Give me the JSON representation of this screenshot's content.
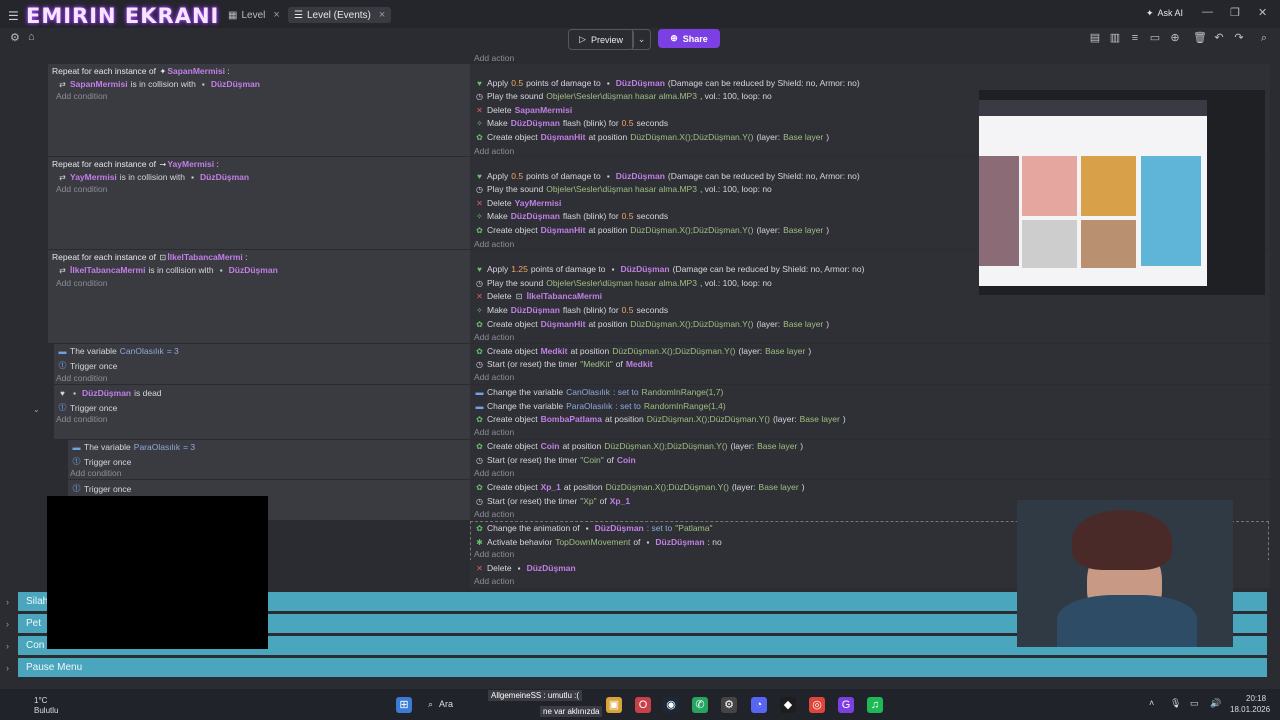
{
  "overlay": {
    "stream_title": "EMIRIN EKRANI"
  },
  "tabs": [
    {
      "label": "Level"
    },
    {
      "label": "Level (Events)"
    }
  ],
  "header": {
    "ask_ai": "Ask AI",
    "preview": "Preview",
    "share": "Share"
  },
  "events": [
    {
      "repeat": "Repeat for each instance of",
      "repeat_obj": "SapanMermisi",
      "cond_obj": "SapanMermisi",
      "cond_mid": "is in collision with",
      "cond_target": "DüzDüşman",
      "add_condition": "Add condition",
      "actions": [
        [
          "Apply",
          "0.5",
          "points of damage to",
          "DüzDüşman",
          "(Damage can be reduced by Shield: no, Armor: no)"
        ],
        [
          "Play the sound",
          "Objeler\\Sesler\\düşman hasar alma.MP3",
          ", vol.: 100, loop: no"
        ],
        [
          "Delete",
          "SapanMermisi"
        ],
        [
          "Make",
          "DüzDüşman",
          "flash (blink) for",
          "0.5",
          "seconds"
        ],
        [
          "Create object",
          "DüşmanHit",
          "at position",
          "DüzDüşman.X();DüzDüşman.Y()",
          "(layer:",
          "Base layer",
          ")"
        ]
      ],
      "add_action": "Add action"
    },
    {
      "repeat": "Repeat for each instance of",
      "repeat_obj": "YayMermisi",
      "cond_obj": "YayMermisi",
      "cond_mid": "is in collision with",
      "cond_target": "DüzDüşman",
      "add_condition": "Add condition",
      "actions": [
        [
          "Apply",
          "0.5",
          "points of damage to",
          "DüzDüşman",
          "(Damage can be reduced by Shield: no, Armor: no)"
        ],
        [
          "Play the sound",
          "Objeler\\Sesler\\düşman hasar alma.MP3",
          ", vol.: 100, loop: no"
        ],
        [
          "Delete",
          "YayMermisi"
        ],
        [
          "Make",
          "DüzDüşman",
          "flash (blink) for",
          "0.5",
          "seconds"
        ],
        [
          "Create object",
          "DüşmanHit",
          "at position",
          "DüzDüşman.X();DüzDüşman.Y()",
          "(layer:",
          "Base layer",
          ")"
        ]
      ],
      "add_action": "Add action"
    },
    {
      "repeat": "Repeat for each instance of",
      "repeat_obj": "İlkelTabancaMermi",
      "cond_obj": "İlkelTabancaMermi",
      "cond_mid": "is in collision with",
      "cond_target": "DüzDüşman",
      "add_condition": "Add condition",
      "actions": [
        [
          "Apply",
          "1.25",
          "points of damage to",
          "DüzDüşman",
          "(Damage can be reduced by Shield: no, Armor: no)"
        ],
        [
          "Play the sound",
          "Objeler\\Sesler\\düşman hasar alma.MP3",
          ", vol.: 100, loop: no"
        ],
        [
          "Delete",
          "İlkelTabancaMermi"
        ],
        [
          "Make",
          "DüzDüşman",
          "flash (blink) for",
          "0.5",
          "seconds"
        ],
        [
          "Create object",
          "DüşmanHit",
          "at position",
          "DüzDüşman.X();DüzDüşman.Y()",
          "(layer:",
          "Base layer",
          ")"
        ]
      ],
      "add_action": "Add action"
    }
  ],
  "medkit_event": {
    "cond1": "The variable",
    "var": "CanOlasılık",
    "eq": "= 3",
    "cond2": "Trigger once",
    "add_condition": "Add condition",
    "act1": [
      "Create object",
      "Medkit",
      "at position",
      "DüzDüşman.X();DüzDüşman.Y()",
      "(layer:",
      "Base layer",
      ")"
    ],
    "act2": [
      "Start (or reset) the timer",
      "\"MedKit\"",
      "of",
      "Medkit"
    ],
    "add_action": "Add action"
  },
  "dead_event": {
    "obj": "DüzDüşman",
    "cond": "is dead",
    "cond2": "Trigger once",
    "add_condition": "Add condition",
    "act1": [
      "Change the variable",
      "CanOlasılık",
      ": set to",
      "RandomInRange(1,7)"
    ],
    "act2": [
      "Change the variable",
      "ParaOlasılık",
      ": set to",
      "RandomInRange(1,4)"
    ],
    "act3": [
      "Create object",
      "BombaPatlama",
      "at position",
      "DüzDüşman.X();DüzDüşman.Y()",
      "(layer:",
      "Base layer",
      ")"
    ],
    "add_action": "Add action"
  },
  "coin_event": {
    "cond1": "The variable",
    "var": "ParaOlasılık",
    "eq": "= 3",
    "cond2": "Trigger once",
    "add_condition": "Add condition",
    "act1": [
      "Create object",
      "Coin",
      "at position",
      "DüzDüşman.X();DüzDüşman.Y()",
      "(layer:",
      "Base layer",
      ")"
    ],
    "act2": [
      "Start (or reset) the timer",
      "\"Coin\"",
      "of",
      "Coin"
    ],
    "add_action": "Add action"
  },
  "xp_event": {
    "cond": "Trigger once",
    "act1": [
      "Create object",
      "Xp_1",
      "at position",
      "DüzDüşman.X();DüzDüşman.Y()",
      "(layer:",
      "Base layer",
      ")"
    ],
    "act2": [
      "Start (or reset) the timer",
      "\"Xp\"",
      "of",
      "Xp_1"
    ],
    "add_action": "Add action"
  },
  "anim_event": {
    "act1": [
      "Change the animation of",
      "DüzDüşman",
      ": set to",
      "\"Patlama\""
    ],
    "act2": [
      "Activate behavior",
      "TopDownMovement",
      "of",
      "DüzDüşman",
      ": no"
    ],
    "add_action": "Add action"
  },
  "delete_event": {
    "act1": [
      "Delete",
      "DüzDüşman"
    ],
    "add_action": "Add action"
  },
  "top_add_action": "Add action",
  "groups": [
    {
      "label": "Silah"
    },
    {
      "label": "Pet"
    },
    {
      "label": "Con"
    },
    {
      "label": "Pause Menu"
    }
  ],
  "taskbar": {
    "weather_temp": "1°C",
    "weather_desc": "Bulutlu",
    "search": "Ara",
    "notif1": "AllgemeineSS : umutlu :(",
    "notif2": "ne var aklınızda",
    "time": "20:18",
    "date": "18.01.2026"
  },
  "colors": {
    "accent": "#7b3fe4",
    "group": "#4aa6bd",
    "object": "#c27fe6"
  }
}
